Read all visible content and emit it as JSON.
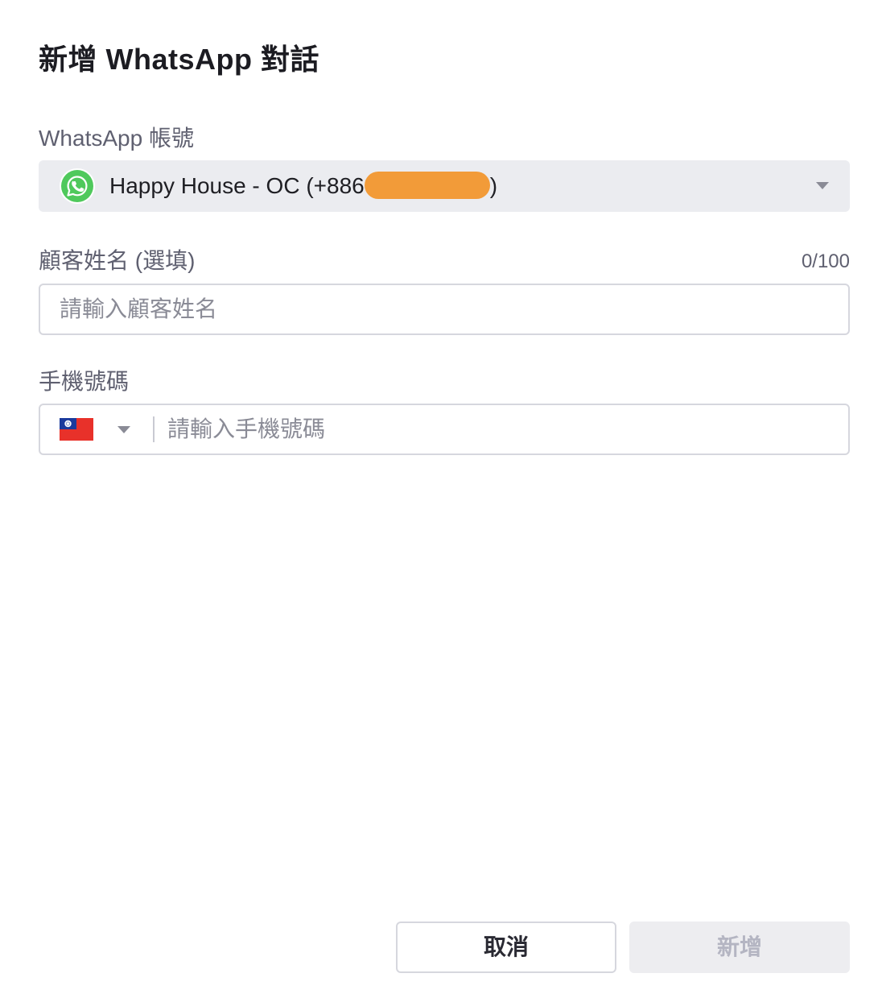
{
  "dialog": {
    "title": "新增 WhatsApp 對話"
  },
  "account": {
    "label": "WhatsApp 帳號",
    "selected_prefix": "Happy House - OC (+886",
    "selected_suffix": ")",
    "icon": "whatsapp-icon"
  },
  "customer_name": {
    "label": "顧客姓名 (選填)",
    "counter": "0/100",
    "placeholder": "請輸入顧客姓名",
    "value": ""
  },
  "phone": {
    "label": "手機號碼",
    "country_flag": "taiwan-flag-icon",
    "placeholder": "請輸入手機號碼",
    "value": ""
  },
  "actions": {
    "cancel_label": "取消",
    "add_label": "新增"
  },
  "colors": {
    "whatsapp_green": "#4fc95c",
    "redaction": "#f29b39",
    "select_bg": "#ebecf0",
    "disabled_button_bg": "#ededf0",
    "disabled_button_text": "#b4b5c2"
  }
}
